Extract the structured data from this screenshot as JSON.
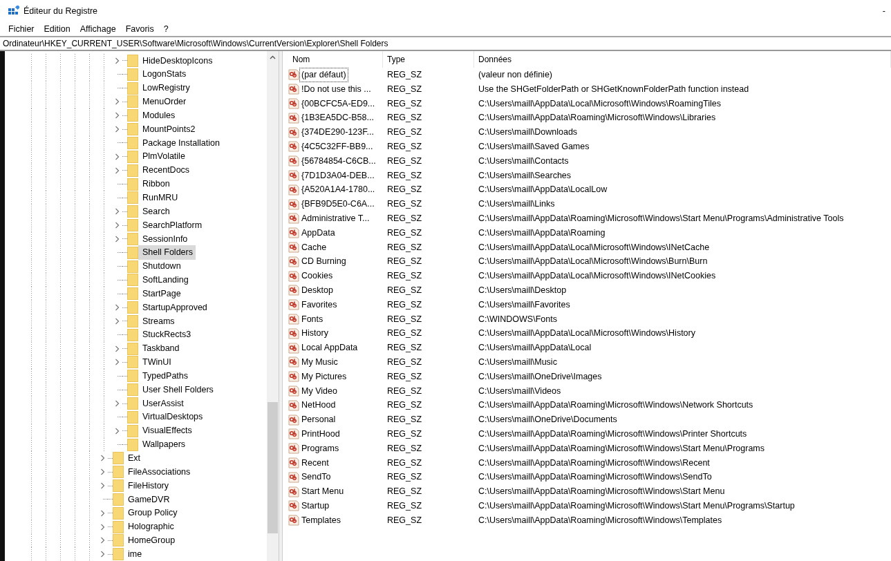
{
  "window": {
    "title": "Éditeur du Registre",
    "minimize": "-"
  },
  "menu": [
    "Fichier",
    "Edition",
    "Affichage",
    "Favoris",
    "?"
  ],
  "address": "Ordinateur\\HKEY_CURRENT_USER\\Software\\Microsoft\\Windows\\CurrentVersion\\Explorer\\Shell Folders",
  "tree": {
    "items": [
      {
        "children": [
          {
            "label": "HideDesktopIcons",
            "expandable": true,
            "selected": false
          },
          {
            "label": "LogonStats",
            "expandable": false,
            "selected": false
          },
          {
            "label": "LowRegistry",
            "expandable": false,
            "selected": false
          },
          {
            "label": "MenuOrder",
            "expandable": true,
            "selected": false
          },
          {
            "label": "Modules",
            "expandable": true,
            "selected": false
          },
          {
            "label": "MountPoints2",
            "expandable": true,
            "selected": false
          },
          {
            "label": "Package Installation",
            "expandable": false,
            "selected": false
          },
          {
            "label": "PlmVolatile",
            "expandable": true,
            "selected": false
          },
          {
            "label": "RecentDocs",
            "expandable": true,
            "selected": false
          },
          {
            "label": "Ribbon",
            "expandable": false,
            "selected": false
          },
          {
            "label": "RunMRU",
            "expandable": false,
            "selected": false
          },
          {
            "label": "Search",
            "expandable": true,
            "selected": false
          },
          {
            "label": "SearchPlatform",
            "expandable": true,
            "selected": false
          },
          {
            "label": "SessionInfo",
            "expandable": true,
            "selected": false
          },
          {
            "label": "Shell Folders",
            "expandable": false,
            "selected": true
          },
          {
            "label": "Shutdown",
            "expandable": false,
            "selected": false
          },
          {
            "label": "SoftLanding",
            "expandable": false,
            "selected": false
          },
          {
            "label": "StartPage",
            "expandable": false,
            "selected": false
          },
          {
            "label": "StartupApproved",
            "expandable": true,
            "selected": false
          },
          {
            "label": "Streams",
            "expandable": true,
            "selected": false
          },
          {
            "label": "StuckRects3",
            "expandable": false,
            "selected": false
          },
          {
            "label": "Taskband",
            "expandable": true,
            "selected": false
          },
          {
            "label": "TWinUI",
            "expandable": true,
            "selected": false
          },
          {
            "label": "TypedPaths",
            "expandable": false,
            "selected": false
          },
          {
            "label": "User Shell Folders",
            "expandable": false,
            "selected": false
          },
          {
            "label": "UserAssist",
            "expandable": true,
            "selected": false
          },
          {
            "label": "VirtualDesktops",
            "expandable": false,
            "selected": false
          },
          {
            "label": "VisualEffects",
            "expandable": true,
            "selected": false
          },
          {
            "label": "Wallpapers",
            "expandable": false,
            "selected": false
          }
        ]
      },
      {
        "label": "Ext",
        "expandable": true,
        "selected": false
      },
      {
        "label": "FileAssociations",
        "expandable": true,
        "selected": false
      },
      {
        "label": "FileHistory",
        "expandable": true,
        "selected": false
      },
      {
        "label": "GameDVR",
        "expandable": false,
        "selected": false
      },
      {
        "label": "Group Policy",
        "expandable": true,
        "selected": false
      },
      {
        "label": "Holographic",
        "expandable": true,
        "selected": false
      },
      {
        "label": "HomeGroup",
        "expandable": true,
        "selected": false
      },
      {
        "label": "ime",
        "expandable": true,
        "selected": false
      }
    ]
  },
  "table": {
    "columns": [
      "Nom",
      "Type",
      "Données"
    ],
    "rows": [
      {
        "name": "(par défaut)",
        "type": "REG_SZ",
        "data": "(valeur non définie)",
        "focused": true
      },
      {
        "name": "!Do not use this ...",
        "type": "REG_SZ",
        "data": "Use the SHGetFolderPath or SHGetKnownFolderPath function instead",
        "focused": false
      },
      {
        "name": "{00BCFC5A-ED9...",
        "type": "REG_SZ",
        "data": "C:\\Users\\maill\\AppData\\Local\\Microsoft\\Windows\\RoamingTiles",
        "focused": false
      },
      {
        "name": "{1B3EA5DC-B58...",
        "type": "REG_SZ",
        "data": "C:\\Users\\maill\\AppData\\Roaming\\Microsoft\\Windows\\Libraries",
        "focused": false
      },
      {
        "name": "{374DE290-123F...",
        "type": "REG_SZ",
        "data": "C:\\Users\\maill\\Downloads",
        "focused": false
      },
      {
        "name": "{4C5C32FF-BB9...",
        "type": "REG_SZ",
        "data": "C:\\Users\\maill\\Saved Games",
        "focused": false
      },
      {
        "name": "{56784854-C6CB...",
        "type": "REG_SZ",
        "data": "C:\\Users\\maill\\Contacts",
        "focused": false
      },
      {
        "name": "{7D1D3A04-DEB...",
        "type": "REG_SZ",
        "data": "C:\\Users\\maill\\Searches",
        "focused": false
      },
      {
        "name": "{A520A1A4-1780...",
        "type": "REG_SZ",
        "data": "C:\\Users\\maill\\AppData\\LocalLow",
        "focused": false
      },
      {
        "name": "{BFB9D5E0-C6A...",
        "type": "REG_SZ",
        "data": "C:\\Users\\maill\\Links",
        "focused": false
      },
      {
        "name": "Administrative T...",
        "type": "REG_SZ",
        "data": "C:\\Users\\maill\\AppData\\Roaming\\Microsoft\\Windows\\Start Menu\\Programs\\Administrative Tools",
        "focused": false
      },
      {
        "name": "AppData",
        "type": "REG_SZ",
        "data": "C:\\Users\\maill\\AppData\\Roaming",
        "focused": false
      },
      {
        "name": "Cache",
        "type": "REG_SZ",
        "data": "C:\\Users\\maill\\AppData\\Local\\Microsoft\\Windows\\INetCache",
        "focused": false
      },
      {
        "name": "CD Burning",
        "type": "REG_SZ",
        "data": "C:\\Users\\maill\\AppData\\Local\\Microsoft\\Windows\\Burn\\Burn",
        "focused": false
      },
      {
        "name": "Cookies",
        "type": "REG_SZ",
        "data": "C:\\Users\\maill\\AppData\\Local\\Microsoft\\Windows\\INetCookies",
        "focused": false
      },
      {
        "name": "Desktop",
        "type": "REG_SZ",
        "data": "C:\\Users\\maill\\Desktop",
        "focused": false
      },
      {
        "name": "Favorites",
        "type": "REG_SZ",
        "data": "C:\\Users\\maill\\Favorites",
        "focused": false
      },
      {
        "name": "Fonts",
        "type": "REG_SZ",
        "data": "C:\\WINDOWS\\Fonts",
        "focused": false
      },
      {
        "name": "History",
        "type": "REG_SZ",
        "data": "C:\\Users\\maill\\AppData\\Local\\Microsoft\\Windows\\History",
        "focused": false
      },
      {
        "name": "Local AppData",
        "type": "REG_SZ",
        "data": "C:\\Users\\maill\\AppData\\Local",
        "focused": false
      },
      {
        "name": "My Music",
        "type": "REG_SZ",
        "data": "C:\\Users\\maill\\Music",
        "focused": false
      },
      {
        "name": "My Pictures",
        "type": "REG_SZ",
        "data": "C:\\Users\\maill\\OneDrive\\Images",
        "focused": false
      },
      {
        "name": "My Video",
        "type": "REG_SZ",
        "data": "C:\\Users\\maill\\Videos",
        "focused": false
      },
      {
        "name": "NetHood",
        "type": "REG_SZ",
        "data": "C:\\Users\\maill\\AppData\\Roaming\\Microsoft\\Windows\\Network Shortcuts",
        "focused": false
      },
      {
        "name": "Personal",
        "type": "REG_SZ",
        "data": "C:\\Users\\maill\\OneDrive\\Documents",
        "focused": false
      },
      {
        "name": "PrintHood",
        "type": "REG_SZ",
        "data": "C:\\Users\\maill\\AppData\\Roaming\\Microsoft\\Windows\\Printer Shortcuts",
        "focused": false
      },
      {
        "name": "Programs",
        "type": "REG_SZ",
        "data": "C:\\Users\\maill\\AppData\\Roaming\\Microsoft\\Windows\\Start Menu\\Programs",
        "focused": false
      },
      {
        "name": "Recent",
        "type": "REG_SZ",
        "data": "C:\\Users\\maill\\AppData\\Roaming\\Microsoft\\Windows\\Recent",
        "focused": false
      },
      {
        "name": "SendTo",
        "type": "REG_SZ",
        "data": "C:\\Users\\maill\\AppData\\Roaming\\Microsoft\\Windows\\SendTo",
        "focused": false
      },
      {
        "name": "Start Menu",
        "type": "REG_SZ",
        "data": "C:\\Users\\maill\\AppData\\Roaming\\Microsoft\\Windows\\Start Menu",
        "focused": false
      },
      {
        "name": "Startup",
        "type": "REG_SZ",
        "data": "C:\\Users\\maill\\AppData\\Roaming\\Microsoft\\Windows\\Start Menu\\Programs\\Startup",
        "focused": false
      },
      {
        "name": "Templates",
        "type": "REG_SZ",
        "data": "C:\\Users\\maill\\AppData\\Roaming\\Microsoft\\Windows\\Templates",
        "focused": false
      }
    ]
  }
}
